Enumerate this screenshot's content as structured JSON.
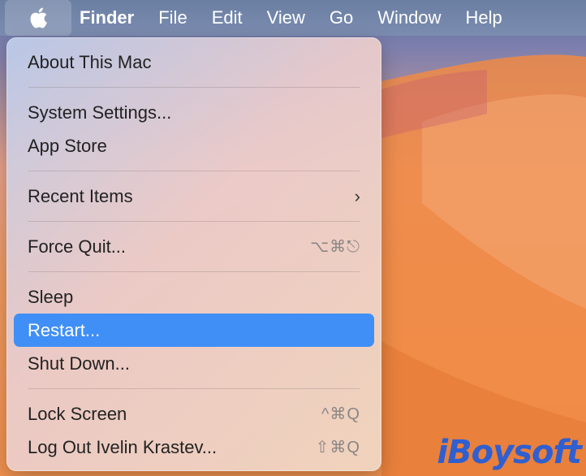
{
  "menubar": {
    "apple_icon": "apple-logo-icon",
    "items": [
      "Finder",
      "File",
      "Edit",
      "View",
      "Go",
      "Window",
      "Help"
    ]
  },
  "apple_menu": {
    "about": "About This Mac",
    "system_settings": "System Settings...",
    "app_store": "App Store",
    "recent_items": "Recent Items",
    "recent_items_chevron": "›",
    "force_quit": "Force Quit...",
    "force_quit_shortcut": "⌥⌘⎋",
    "sleep": "Sleep",
    "restart": "Restart...",
    "shut_down": "Shut Down...",
    "lock_screen": "Lock Screen",
    "lock_screen_shortcut": "^⌘Q",
    "log_out": "Log Out Ivelin Krastev...",
    "log_out_shortcut": "⇧⌘Q"
  },
  "watermark": "iBoysoft",
  "colors": {
    "highlight": "#3f8ff7",
    "menubar": "#6b7fa3",
    "wallpaper": "#ef914f",
    "watermark": "#2f5fd0"
  }
}
